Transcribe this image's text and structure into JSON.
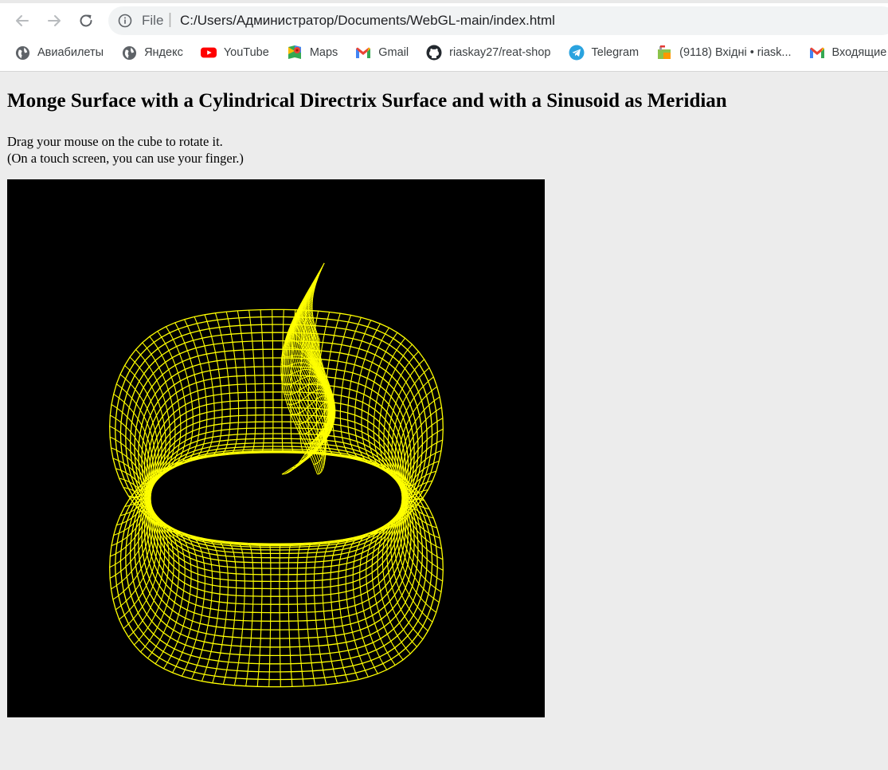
{
  "browser": {
    "nav": {
      "back_icon": "arrow-left-icon",
      "forward_icon": "arrow-right-icon",
      "reload_icon": "reload-icon"
    },
    "address_bar": {
      "info_icon": "info-icon",
      "scheme_label": "File",
      "url": "C:/Users/Администратор/Documents/WebGL-main/index.html"
    },
    "bookmarks": [
      {
        "label": "Авиабилеты",
        "icon": "globe-icon"
      },
      {
        "label": "Яндекс",
        "icon": "globe-icon"
      },
      {
        "label": "YouTube",
        "icon": "youtube-icon"
      },
      {
        "label": "Maps",
        "icon": "maps-pin-icon"
      },
      {
        "label": "Gmail",
        "icon": "gmail-icon"
      },
      {
        "label": "riaskay27/reat-shop",
        "icon": "github-icon"
      },
      {
        "label": "Telegram",
        "icon": "telegram-icon"
      },
      {
        "label": "(9118) Вхідні • riask...",
        "icon": "mailbox-icon"
      },
      {
        "label": "Входящие",
        "icon": "gmail-icon"
      }
    ]
  },
  "page": {
    "title": "Monge Surface with a Cylindrical Directrix Surface and with a Sinusoid as Meridian",
    "instruction_line1": "Drag your mouse on the cube to rotate it.",
    "instruction_line2": "(On a touch screen, you can use your finger.)"
  },
  "canvas": {
    "background_color": "#000000",
    "wire_color": "#ffff00"
  }
}
